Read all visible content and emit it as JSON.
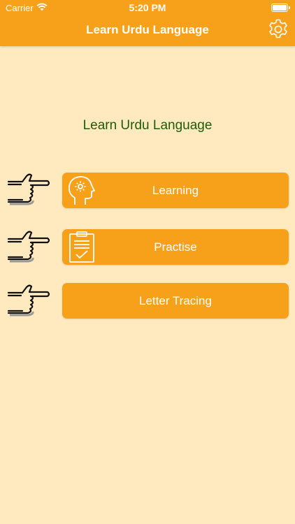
{
  "status_bar": {
    "carrier": "Carrier",
    "time": "5:20 PM",
    "icons": [
      "wifi-icon",
      "battery-icon"
    ]
  },
  "nav": {
    "title": "Learn Urdu Language",
    "settings_icon": "gear-icon"
  },
  "main": {
    "title": "Learn Urdu Language",
    "menu": [
      {
        "label": "Learning",
        "icon": "head-gear-icon",
        "pointer_icon": "pointing-hand-icon"
      },
      {
        "label": "Practise",
        "icon": "clipboard-check-icon",
        "pointer_icon": "pointing-hand-icon"
      },
      {
        "label": "Letter Tracing",
        "icon": "",
        "pointer_icon": "pointing-hand-icon"
      }
    ]
  },
  "colors": {
    "background": "#FFEAC0",
    "accent": "#F7A11A",
    "title_text": "#1D5C07",
    "button_text": "#FFFFFF"
  }
}
